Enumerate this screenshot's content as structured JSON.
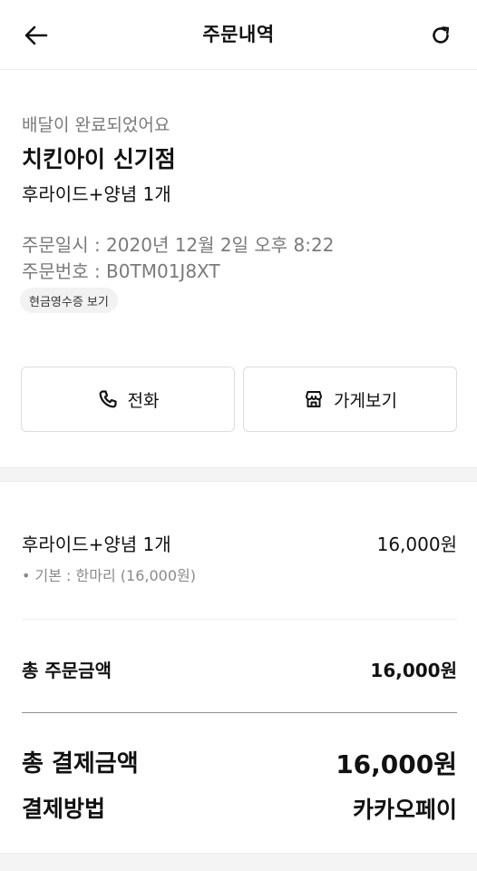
{
  "header": {
    "title": "주문내역",
    "back_icon": "arrow-left-icon",
    "refresh_icon": "refresh-icon"
  },
  "order": {
    "status": "배달이 완료되었어요",
    "store_name": "치킨아이 신기점",
    "summary": "후라이드+양념 1개",
    "date_line": "주문일시 : 2020년 12월 2일 오후 8:22",
    "number_line": "주문번호 : B0TM01J8XT",
    "receipt_label": "현금영수증 보기"
  },
  "actions": {
    "call_label": "전화",
    "call_icon": "phone-icon",
    "store_label": "가게보기",
    "store_icon": "store-icon"
  },
  "items": [
    {
      "name": "후라이드+양념 1개",
      "price": "16,000원",
      "option": "• 기본 : 한마리 (16,000원)"
    }
  ],
  "totals": {
    "order_total_label": "총 주문금액",
    "order_total_value": "16,000원",
    "payment_total_label": "총 결제금액",
    "payment_total_value": "16,000원",
    "payment_method_label": "결제방법",
    "payment_method_value": "카카오페이"
  }
}
